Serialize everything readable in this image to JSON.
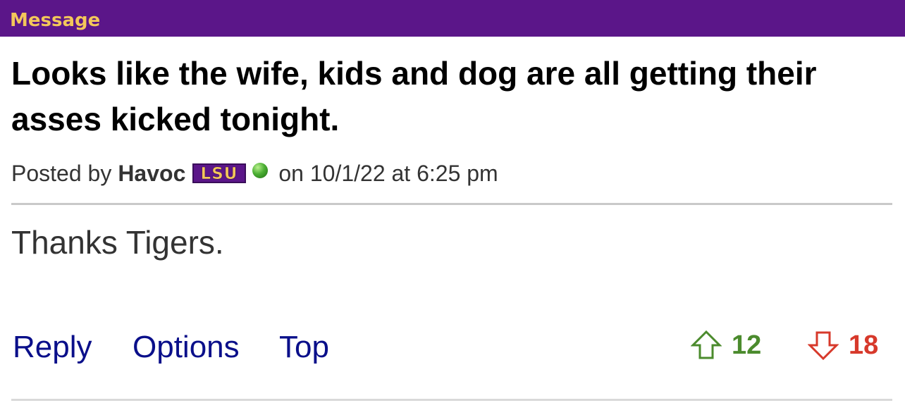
{
  "header": {
    "title": "Message",
    "bg_color": "#5b1689",
    "title_color": "#f3c75a"
  },
  "post": {
    "title": "Looks like the wife, kids and dog are all getting their asses kicked tonight.",
    "byline_prefix": "Posted by",
    "author": "Havoc",
    "badge_text": "LSU",
    "status_icon": "green-online-dot-icon",
    "date_text": "on 10/1/22 at 6:25 pm",
    "body": "Thanks Tigers."
  },
  "actions": {
    "reply_label": "Reply",
    "options_label": "Options",
    "top_label": "Top",
    "link_color": "#0a0f8a"
  },
  "votes": {
    "up_count": "12",
    "down_count": "18",
    "up_color": "#4b8b2d",
    "down_color": "#d7392b"
  }
}
